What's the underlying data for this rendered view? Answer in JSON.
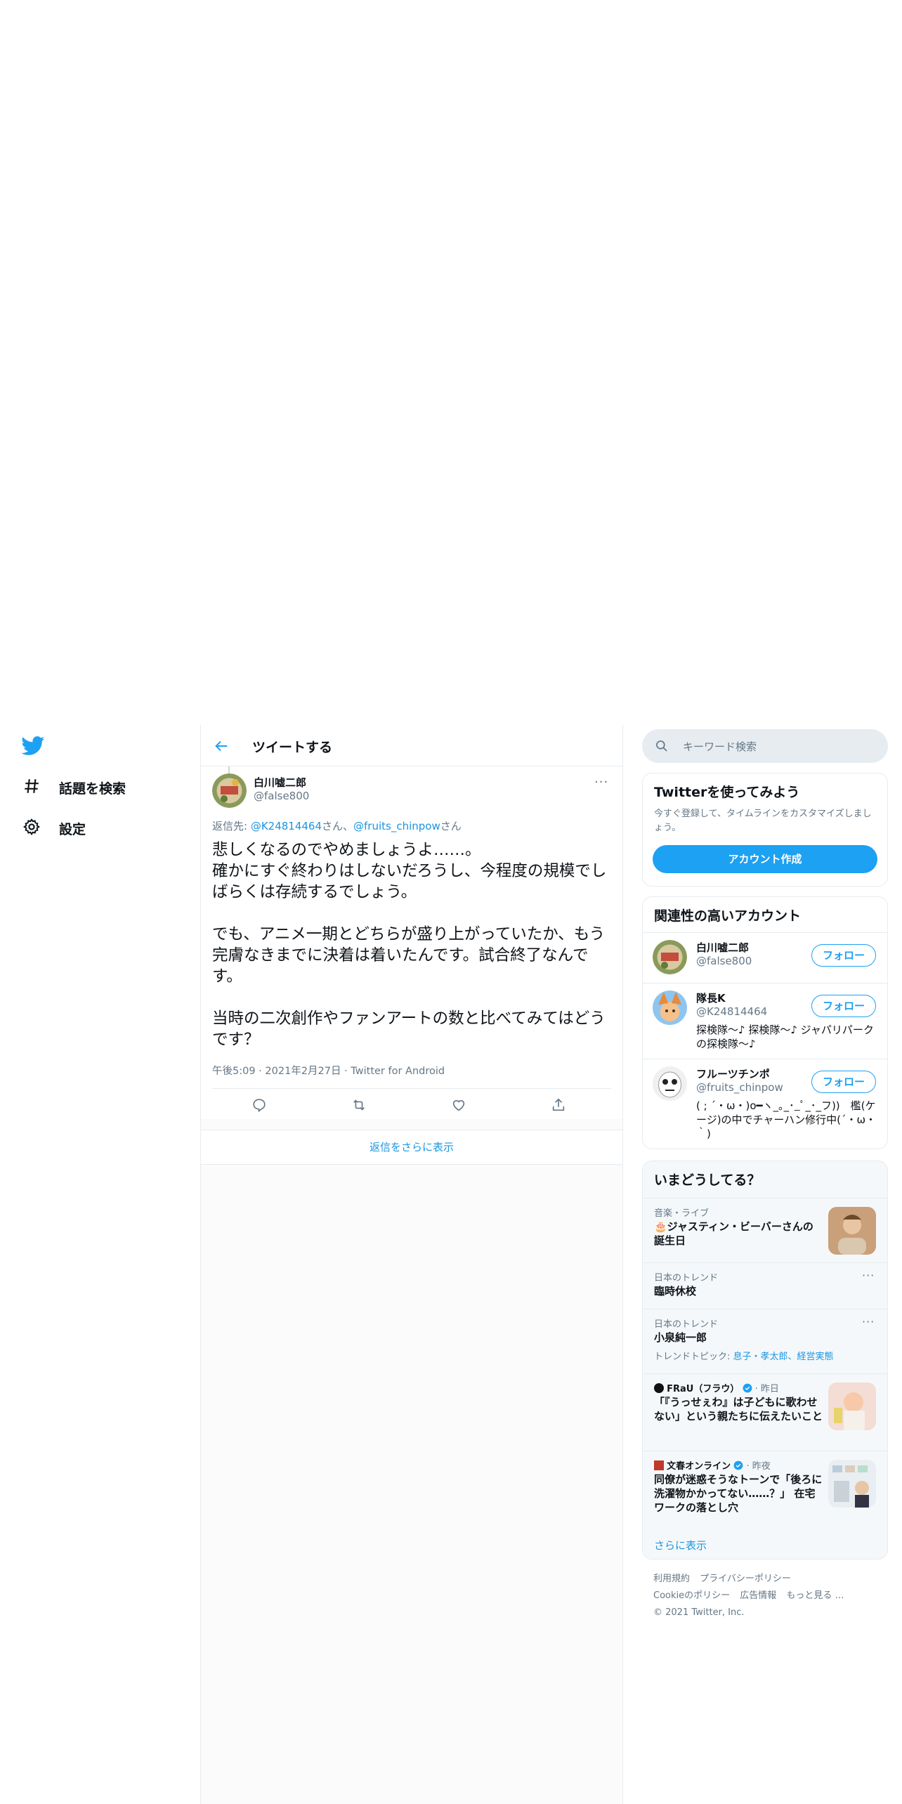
{
  "nav": {
    "logo": "twitter-bird-icon",
    "items": [
      {
        "label": "話題を検索",
        "icon": "hashtag-icon"
      },
      {
        "label": "設定",
        "icon": "gear-icon"
      }
    ]
  },
  "header": {
    "title": "ツイートする"
  },
  "tweet": {
    "name": "白川嘘二郎",
    "handle": "@false800",
    "reply_prefix": "返信先: ",
    "reply_user1": "@K24814464",
    "reply_sep": "さん、",
    "reply_user2": "@fruits_chinpow",
    "reply_suffix": "さん",
    "body": "悲しくなるのでやめましょうよ……。\n確かにすぐ終わりはしないだろうし、今程度の規模でしばらくは存続するでしょう。\n\nでも、アニメ一期とどちらが盛り上がっていたか、もう完膚なきまでに決着は着いたんです。試合終了なんです。\n\n当時の二次創作やファンアートの数と比べてみてはどうです？",
    "meta": "午後5:09 · 2021年2月27日 · Twitter for Android",
    "more_replies": "返信をさらに表示"
  },
  "search": {
    "placeholder": "キーワード検索"
  },
  "signup": {
    "title": "Twitterを使ってみよう",
    "desc": "今すぐ登録して、タイムラインをカスタマイズしましょう。",
    "button": "アカウント作成"
  },
  "who_to_follow": {
    "title": "関連性の高いアカウント",
    "follow_label": "フォロー",
    "accounts": [
      {
        "name": "白川嘘二郎",
        "handle": "@false800",
        "bio": ""
      },
      {
        "name": "隊長K",
        "handle": "@K24814464",
        "bio": "探検隊～♪ 探検隊～♪ ジャパリパークの探検隊～♪"
      },
      {
        "name": "フルーツチンポ",
        "handle": "@fruits_chinpow",
        "bio": "( ; ´・ω・)o━ヽ_｡_･_ﾟ_･_フ))　檻(ケージ)の中でチャーハン修行中(´・ω・｀)"
      }
    ]
  },
  "trends": {
    "title": "いまどうしてる？",
    "items": [
      {
        "category": "音楽・ライブ",
        "title": "🎂ジャスティン・ビーバーさんの誕生日"
      },
      {
        "category": "日本のトレンド",
        "title": "臨時休校"
      },
      {
        "category": "日本のトレンド",
        "title": "小泉純一郎",
        "sub_prefix": "トレンドトピック: ",
        "sub_links": "息子・孝太郎、経営実態"
      },
      {
        "source": "FRaU（フラウ）",
        "time": "· 昨日",
        "title": "「『うっせぇわ』は子どもに歌わせない」という親たちに伝えたいこと"
      },
      {
        "source": "文春オンライン",
        "time": "· 昨夜",
        "title": "同僚が迷惑そうなトーンで「後ろに洗濯物かかってない……？」 在宅ワークの落とし穴"
      }
    ],
    "show_more": "さらに表示"
  },
  "footer": {
    "links": [
      "利用規約",
      "プライバシーポリシー",
      "Cookieのポリシー",
      "広告情報",
      "もっと見る …"
    ],
    "copyright": "© 2021 Twitter, Inc."
  }
}
